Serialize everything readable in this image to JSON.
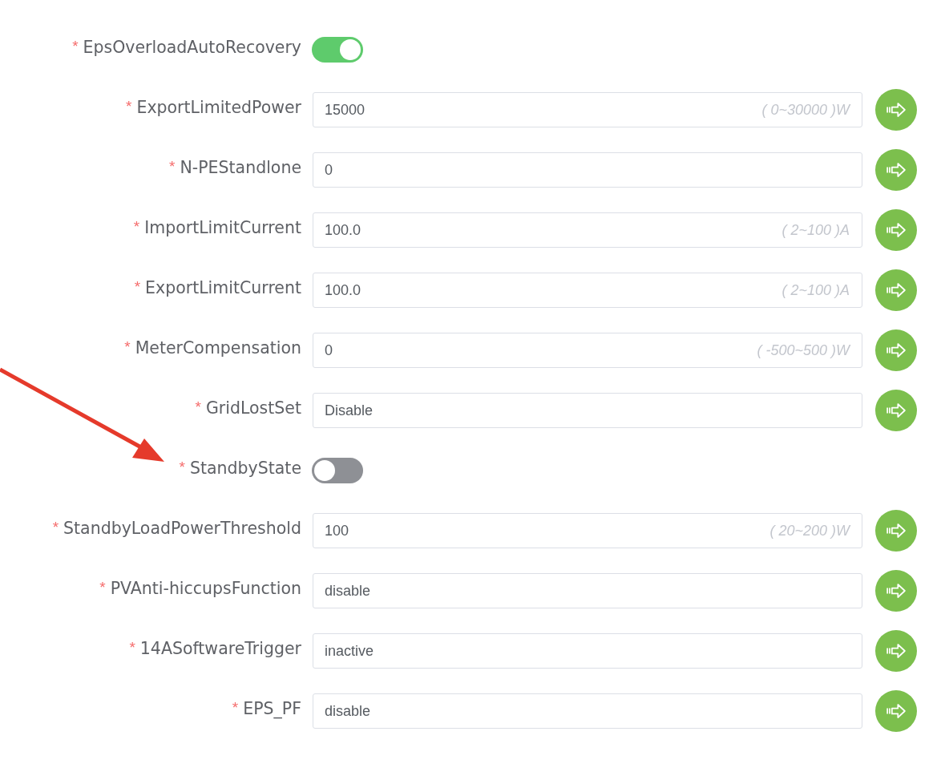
{
  "fields": [
    {
      "kind": "switch",
      "required_mark": "*",
      "label": "EpsOverloadAutoRecovery",
      "on": true,
      "pointed": false
    },
    {
      "kind": "input",
      "required_mark": "*",
      "label": "ExportLimitedPower",
      "value": "15000",
      "range": "( 0~30000 )W",
      "pointed": false
    },
    {
      "kind": "input",
      "required_mark": "*",
      "label": "N-PEStandlone",
      "value": "0",
      "pointed": false
    },
    {
      "kind": "input",
      "required_mark": "*",
      "label": "ImportLimitCurrent",
      "value": "100.0",
      "range": "( 2~100 )A",
      "pointed": false
    },
    {
      "kind": "input",
      "required_mark": "*",
      "label": "ExportLimitCurrent",
      "value": "100.0",
      "range": "( 2~100 )A",
      "pointed": false
    },
    {
      "kind": "input",
      "required_mark": "*",
      "label": "MeterCompensation",
      "value": "0",
      "range": "( -500~500 )W",
      "pointed": false
    },
    {
      "kind": "input",
      "required_mark": "*",
      "label": "GridLostSet",
      "value": "Disable",
      "pointed": false
    },
    {
      "kind": "switch",
      "required_mark": "*",
      "label": "StandbyState",
      "on": false,
      "pointed": true
    },
    {
      "kind": "input",
      "required_mark": "*",
      "label": "StandbyLoadPowerThreshold",
      "value": "100",
      "range": "( 20~200 )W",
      "pointed": false
    },
    {
      "kind": "input",
      "required_mark": "*",
      "label": "PVAnti-hiccupsFunction",
      "value": "disable",
      "pointed": false
    },
    {
      "kind": "input",
      "required_mark": "*",
      "label": "14ASoftwareTrigger",
      "value": "inactive",
      "pointed": false
    },
    {
      "kind": "input",
      "required_mark": "*",
      "label": "EPS_PF",
      "value": "disable",
      "pointed": false
    }
  ]
}
